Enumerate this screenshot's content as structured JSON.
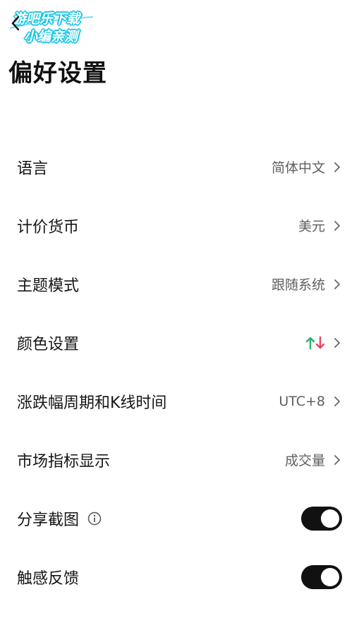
{
  "watermark": {
    "line1": "游吧乐下载",
    "line2": "小编亲测"
  },
  "header": {
    "title": "偏好设置",
    "back_icon": "chevron-left-icon"
  },
  "settings": {
    "language": {
      "label": "语言",
      "value": "简体中文"
    },
    "currency": {
      "label": "计价货币",
      "value": "美元"
    },
    "theme": {
      "label": "主题模式",
      "value": "跟随系统"
    },
    "color": {
      "label": "颜色设置",
      "up_color": "#2ab06f",
      "down_color": "#e8445a"
    },
    "change_period": {
      "label": "涨跌幅周期和K线时间",
      "value": "UTC+8"
    },
    "indicator": {
      "label": "市场指标显示",
      "value": "成交量"
    },
    "share_screenshot": {
      "label": "分享截图",
      "enabled": true,
      "info_icon": "info-icon"
    },
    "haptic": {
      "label": "触感反馈",
      "enabled": true
    }
  },
  "colors": {
    "toggle_on": "#111111",
    "watermark_stroke": "#1ac6e6"
  }
}
